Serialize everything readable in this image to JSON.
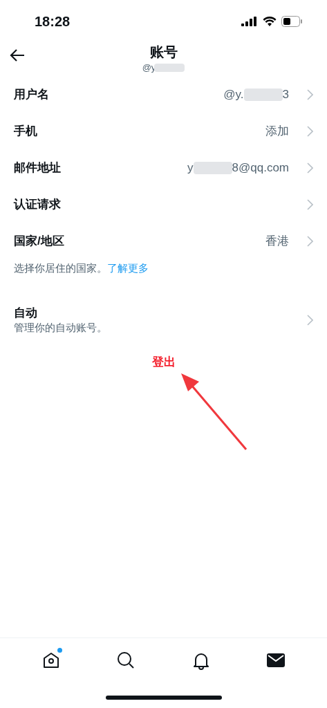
{
  "status_bar": {
    "time": "18:28"
  },
  "header": {
    "title": "账号",
    "handle": "@y",
    "handle_redacted": true
  },
  "rows": [
    {
      "label": "用户名",
      "value": "@y.",
      "redacted": true,
      "value_end": "3"
    },
    {
      "label": "手机",
      "value": "添加",
      "redacted": false
    },
    {
      "label": "邮件地址",
      "value": "y",
      "redacted": true,
      "value_end": "8@qq.com"
    },
    {
      "label": "认证请求",
      "redacted": false
    },
    {
      "label": "国家/地区",
      "value": "香港",
      "redacted": false
    }
  ],
  "hint": {
    "text": "选择你居住的国家。",
    "link": "了解更多"
  },
  "automation": {
    "label": "自动",
    "description": "管理你的自动账号。"
  },
  "logout": "登出",
  "nav": [
    {
      "kind": "home",
      "selected": false,
      "badge": true
    },
    {
      "kind": "search",
      "selected": false,
      "badge": false
    },
    {
      "kind": "bell",
      "selected": false,
      "badge": false
    },
    {
      "kind": "mail",
      "selected": true,
      "badge": false
    }
  ]
}
